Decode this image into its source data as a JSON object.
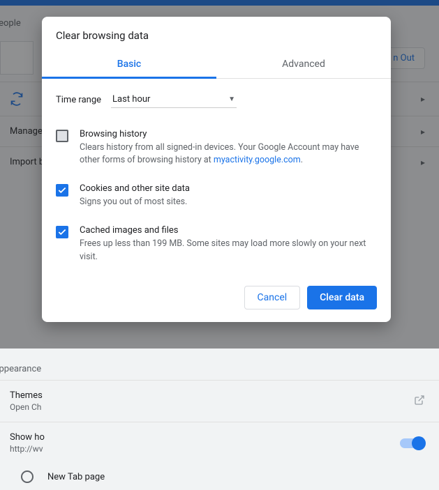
{
  "background": {
    "people_label": "People",
    "sign_out": "n Out",
    "manage": "Manage",
    "import": "Import b",
    "appearance": "Appearance",
    "themes": "Themes",
    "themes_sub": "Open Ch",
    "show_home": "Show ho",
    "show_home_sub": "http://wv",
    "new_tab": "New Tab page"
  },
  "dialog": {
    "title": "Clear browsing data",
    "tabs": {
      "basic": "Basic",
      "advanced": "Advanced"
    },
    "time_label": "Time range",
    "time_value": "Last hour",
    "items": [
      {
        "checked": false,
        "title": "Browsing history",
        "desc_before": "Clears history from all signed-in devices. Your Google Account may have other forms of browsing history at ",
        "link_text": "myactivity.google.com",
        "desc_after": "."
      },
      {
        "checked": true,
        "title": "Cookies and other site data",
        "desc_before": "Signs you out of most sites.",
        "link_text": "",
        "desc_after": ""
      },
      {
        "checked": true,
        "title": "Cached images and files",
        "desc_before": "Frees up less than 199 MB. Some sites may load more slowly on your next visit.",
        "link_text": "",
        "desc_after": ""
      }
    ],
    "cancel": "Cancel",
    "confirm": "Clear data"
  }
}
